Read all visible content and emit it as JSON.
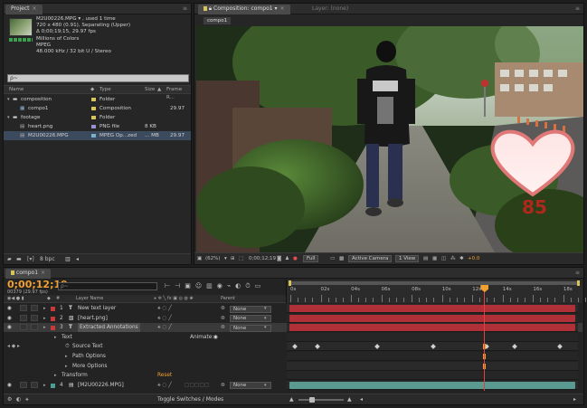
{
  "project": {
    "tab": "Project",
    "footage_info": {
      "name": "M2U00226.MPG",
      "usage": "▾ , used 1 time",
      "line2": "720 x 480 (0.91), Separating (Upper)",
      "line3": "Δ 0;00;19;15, 29.97 fps",
      "line4": "Millions of Colors",
      "line5": "MPEG",
      "line6": "48.000 kHz / 32 bit U / Stereo"
    },
    "search_placeholder": "ρ~",
    "columns": {
      "name": "Name",
      "type": "Type",
      "size": "Size",
      "frame_rate": "Frame R..."
    },
    "items": [
      {
        "name": "composition",
        "type": "Folder",
        "size": "",
        "fr": "",
        "color": "#d8c55a",
        "indent": 0,
        "kind": "folder"
      },
      {
        "name": "compo1",
        "type": "Composition",
        "size": "",
        "fr": "29.97",
        "color": "#d8c55a",
        "indent": 1,
        "kind": "comp"
      },
      {
        "name": "footage",
        "type": "Folder",
        "size": "",
        "fr": "",
        "color": "#d8c55a",
        "indent": 0,
        "kind": "folder"
      },
      {
        "name": "heart.png",
        "type": "PNG file",
        "size": "8 KB",
        "fr": "",
        "color": "#9a8fd0",
        "indent": 1,
        "kind": "file"
      },
      {
        "name": "M2U00226.MPG",
        "type": "MPEG Op...zed",
        "size": "... MB",
        "fr": "29.97",
        "color": "#7ab0c8",
        "indent": 1,
        "kind": "file"
      }
    ],
    "bpc": "8 bpc"
  },
  "composition": {
    "tab": "Composition: compo1",
    "layer_tab": "Layer: (none)",
    "subtab": "compo1",
    "heart_value": "85",
    "controls": {
      "zoom": "(62%)",
      "timecode": "0;00;12;19",
      "resolution": "Full",
      "camera": "Active Camera",
      "view": "1 View",
      "exposure": "+0.0"
    }
  },
  "timeline": {
    "tab": "compo1",
    "timecode": "0;00;12;19",
    "frames": "00379 (29.97 fps)",
    "search_placeholder": "ρ~",
    "col_hash": "#",
    "col_layer_name": "Layer Name",
    "col_parent": "Parent",
    "animate_label": "Animate:",
    "toggle_label": "Toggle Switches / Modes",
    "ruler": [
      "0s",
      "02s",
      "04s",
      "06s",
      "08s",
      "10s",
      "12s",
      "14s",
      "16s",
      "18s"
    ],
    "playhead_fraction": 0.678,
    "layers": [
      {
        "num": "1",
        "name": "New text layer",
        "color": "#c83a3a",
        "parent": "None",
        "icon": "T"
      },
      {
        "num": "2",
        "name": "[heart.png]",
        "color": "#c83a3a",
        "parent": "None",
        "icon": "img"
      },
      {
        "num": "3",
        "name": "Extracted Annotations",
        "color": "#c83a3a",
        "parent": "None",
        "icon": "T"
      },
      {
        "num": "4",
        "name": "[M2U00226.MPG]",
        "color": "#4aa090",
        "parent": "None",
        "icon": "vid"
      }
    ],
    "sub_props": {
      "text": "Text",
      "source_text": "Source Text",
      "path_options": "Path Options",
      "more_options": "More Options",
      "transform": "Transform",
      "reset": "Reset"
    },
    "colors": {
      "accent_orange": "#f0a030",
      "layer_red": "#b03038",
      "layer_teal": "#5a9a90",
      "playhead": "#e04040"
    }
  }
}
